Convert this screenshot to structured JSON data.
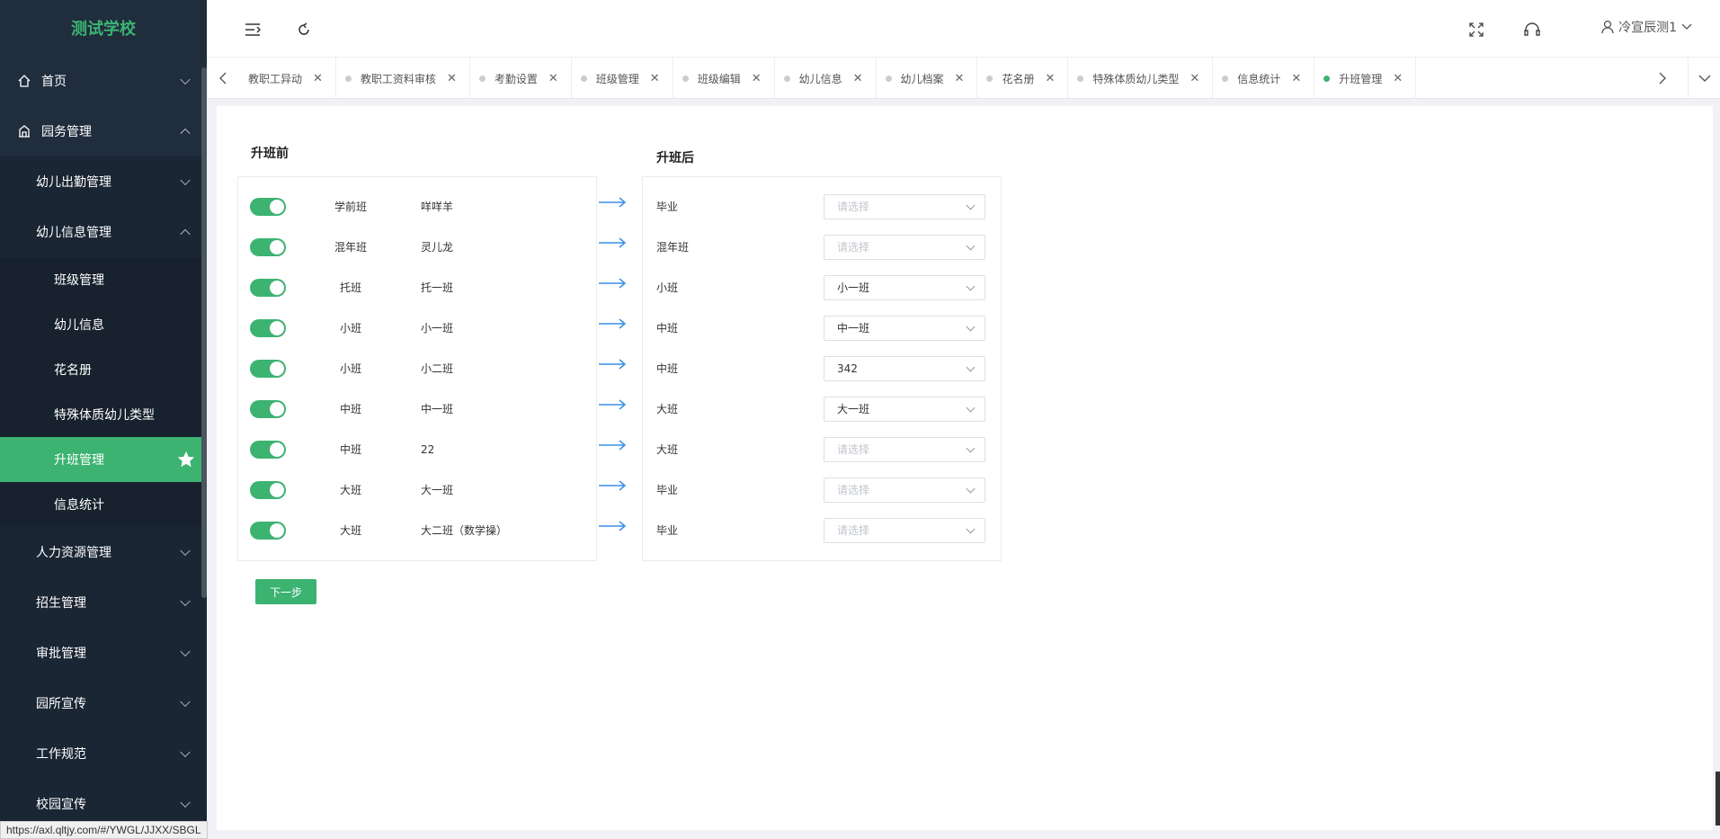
{
  "app": {
    "school_name": "测试学校",
    "accent": "#3cb371"
  },
  "header": {
    "user_name": "冷宣辰测1"
  },
  "sidebar": {
    "top_items": [
      {
        "label": "首页"
      },
      {
        "label": "园务管理"
      }
    ],
    "sub_items": [
      {
        "label": "幼儿出勤管理"
      },
      {
        "label": "幼儿信息管理"
      }
    ],
    "leaf_items": [
      {
        "label": "班级管理"
      },
      {
        "label": "幼儿信息"
      },
      {
        "label": "花名册"
      },
      {
        "label": "特殊体质幼儿类型"
      },
      {
        "label": "升班管理"
      },
      {
        "label": "信息统计"
      }
    ],
    "more_items": [
      {
        "label": "人力资源管理"
      },
      {
        "label": "招生管理"
      },
      {
        "label": "审批管理"
      },
      {
        "label": "园所宣传"
      },
      {
        "label": "工作规范"
      },
      {
        "label": "校园宣传"
      }
    ]
  },
  "tabs": [
    {
      "label": "教职工异动"
    },
    {
      "label": "教职工资料审核"
    },
    {
      "label": "考勤设置"
    },
    {
      "label": "班级管理"
    },
    {
      "label": "班级编辑"
    },
    {
      "label": "幼儿信息"
    },
    {
      "label": "幼儿档案"
    },
    {
      "label": "花名册"
    },
    {
      "label": "特殊体质幼儿类型"
    },
    {
      "label": "信息统计"
    },
    {
      "label": "升班管理"
    }
  ],
  "promotion": {
    "before_title": "升班前",
    "after_title": "升班后",
    "rows": [
      {
        "grade": "学前班",
        "class": "咩咩羊",
        "after_grade": "毕业",
        "after_class": "请选择",
        "placeholder": true
      },
      {
        "grade": "混年班",
        "class": "灵儿龙",
        "after_grade": "混年班",
        "after_class": "请选择",
        "placeholder": true
      },
      {
        "grade": "托班",
        "class": "托一班",
        "after_grade": "小班",
        "after_class": "小一班",
        "placeholder": false
      },
      {
        "grade": "小班",
        "class": "小一班",
        "after_grade": "中班",
        "after_class": "中一班",
        "placeholder": false
      },
      {
        "grade": "小班",
        "class": "小二班",
        "after_grade": "中班",
        "after_class": "342",
        "placeholder": false
      },
      {
        "grade": "中班",
        "class": "中一班",
        "after_grade": "大班",
        "after_class": "大一班",
        "placeholder": false
      },
      {
        "grade": "中班",
        "class": "22",
        "after_grade": "大班",
        "after_class": "请选择",
        "placeholder": true
      },
      {
        "grade": "大班",
        "class": "大一班",
        "after_grade": "毕业",
        "after_class": "请选择",
        "placeholder": true
      },
      {
        "grade": "大班",
        "class": "大二班（数学操）",
        "after_grade": "毕业",
        "after_class": "请选择",
        "placeholder": true
      }
    ],
    "next_label": "下一步"
  },
  "status_bar": {
    "url": "https://axl.qltjy.com/#/YWGL/JJXX/SBGL"
  }
}
